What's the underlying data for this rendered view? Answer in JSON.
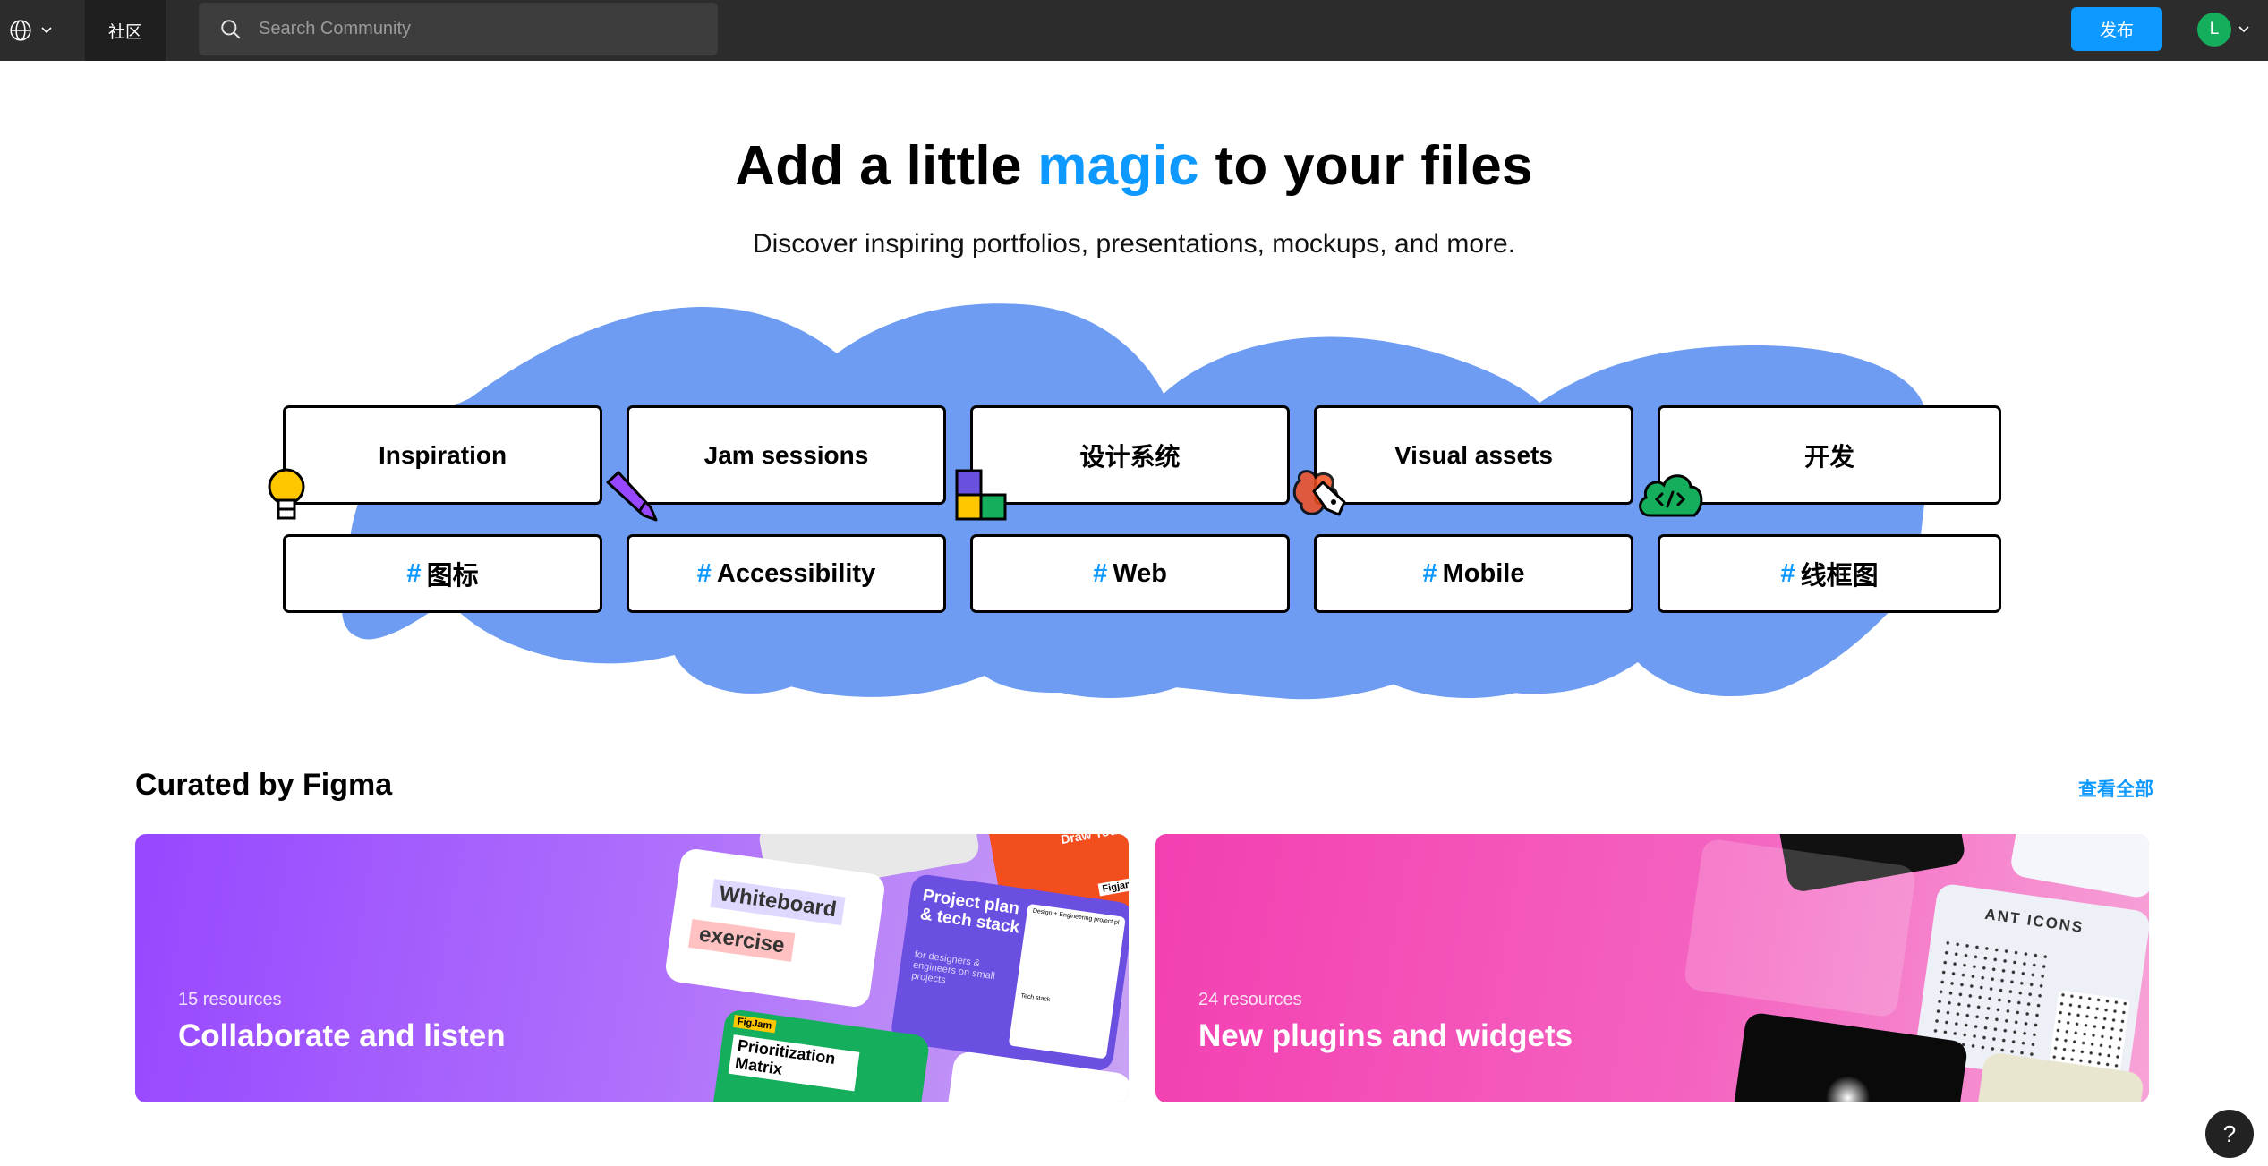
{
  "topbar": {
    "community_label": "社区",
    "search_placeholder": "Search Community",
    "publish_label": "发布",
    "avatar_initial": "L"
  },
  "hero": {
    "title_before": "Add a little ",
    "title_accent": "magic",
    "title_after": " to your files",
    "subtitle": "Discover inspiring portfolios, presentations, mockups, and more."
  },
  "categories": [
    {
      "label": "Inspiration",
      "icon": "lightbulb-icon"
    },
    {
      "label": "Jam sessions",
      "icon": "pencil-icon"
    },
    {
      "label": "设计系统",
      "icon": "blocks-icon"
    },
    {
      "label": "Visual assets",
      "icon": "pen-tool-icon"
    },
    {
      "label": "开发",
      "icon": "code-cloud-icon"
    }
  ],
  "tags": [
    {
      "hash": "#",
      "label": "图标"
    },
    {
      "hash": "#",
      "label": "Accessibility"
    },
    {
      "hash": "#",
      "label": "Web"
    },
    {
      "hash": "#",
      "label": "Mobile"
    },
    {
      "hash": "#",
      "label": "线框图"
    }
  ],
  "curated": {
    "title": "Curated by Figma",
    "view_all": "查看全部",
    "cards": [
      {
        "count": "15 resources",
        "title": "Collaborate and listen",
        "thumbs": {
          "whiteboard": "Whiteboard",
          "exercise": "exercise",
          "project_plan": "Project plan & tech stack",
          "project_sub": "for designers & engineers on small projects",
          "prioritization": "Prioritization Matrix",
          "figjam": "FigJam",
          "draw": "Draw Your F",
          "figjam2": "Figjam",
          "design_plan": "Design + Engineering project pl",
          "tech_stack": "Tech stack"
        }
      },
      {
        "count": "24 resources",
        "title": "New plugins and widgets",
        "thumbs": {
          "ant_icons": "ANT ICONS"
        }
      }
    ]
  },
  "colors": {
    "accent": "#0d99ff",
    "blob": "#6e9cf3",
    "topbar": "#2c2c2c",
    "avatar": "#14ae5c"
  },
  "help": "?"
}
